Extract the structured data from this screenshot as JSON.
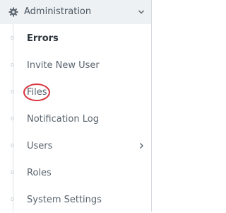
{
  "header": {
    "title": "Administration",
    "icon": "gear-icon",
    "toggle_icon": "chevron-down-icon"
  },
  "menu": {
    "items": [
      {
        "label": "Errors",
        "active": true
      },
      {
        "label": "Invite New User"
      },
      {
        "label": "Files",
        "highlighted": true
      },
      {
        "label": "Notification Log"
      },
      {
        "label": "Users",
        "has_submenu": true,
        "submenu_icon": "chevron-right-icon"
      },
      {
        "label": "Roles"
      },
      {
        "label": "System Settings"
      }
    ]
  },
  "colors": {
    "header_bg": "#eef1f3",
    "text": "#59636c",
    "active_text": "#2c343b",
    "highlight_ring": "#d8343d"
  }
}
